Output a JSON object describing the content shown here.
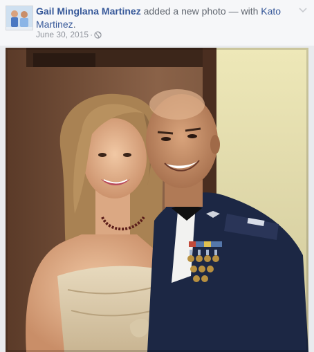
{
  "post": {
    "author": "Gail Minglana Martinez",
    "action_text": " added a new photo — with ",
    "tagged_person_part1": "Kato",
    "tagged_person_part2": "Martinez",
    "period": ".",
    "date": "June 30, 2015",
    "separator": "·",
    "privacy_icon": "globe-icon",
    "menu_icon": "chevron-down-icon"
  },
  "colors": {
    "link": "#365899",
    "meta": "#90949c",
    "header_bg": "#f6f7f9",
    "page_bg": "#e9ebee",
    "uniform": "#1c2744"
  }
}
